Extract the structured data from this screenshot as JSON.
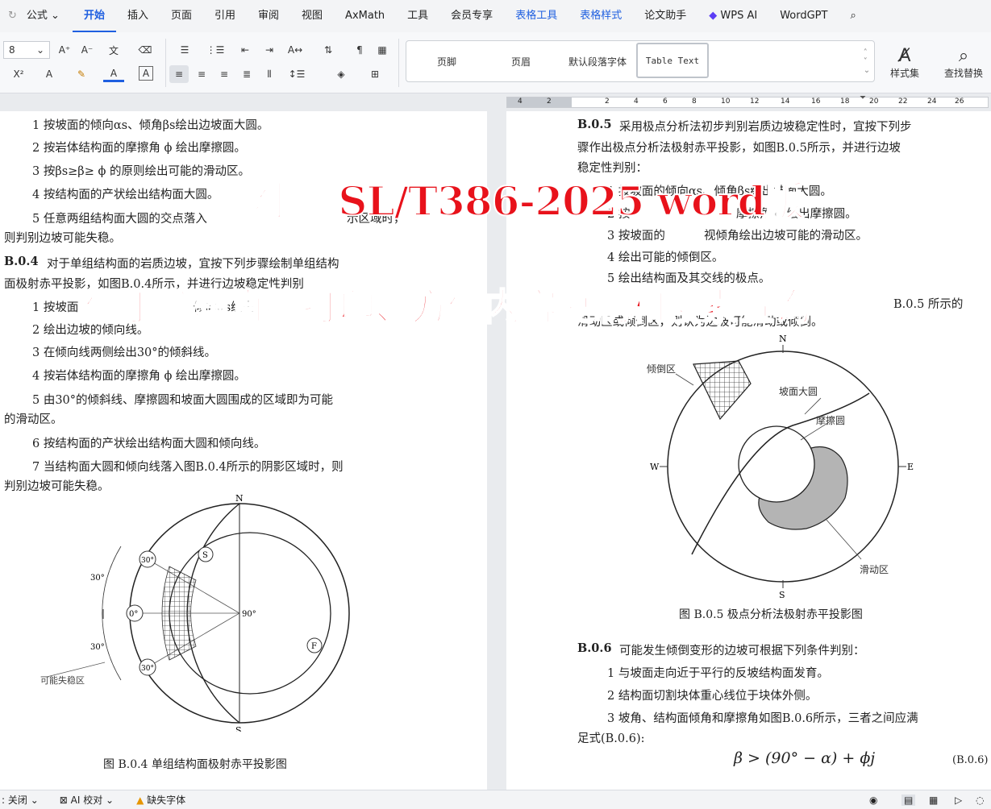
{
  "tabs": {
    "formula": "公式",
    "start": "开始",
    "insert": "插入",
    "page": "页面",
    "reference": "引用",
    "review": "审阅",
    "view": "视图",
    "axmath": "AxMath",
    "tools": "工具",
    "member": "会员专享",
    "table_tools": "表格工具",
    "table_style": "表格样式",
    "paper": "论文助手",
    "wps_ai": "WPS AI",
    "wordgpt": "WordGPT"
  },
  "ribbon": {
    "font_size": "8",
    "styles": [
      "页脚",
      "页眉",
      "默认段落字体",
      "Table Text"
    ],
    "styles_set": "样式集",
    "find_replace": "查找替换"
  },
  "ruler": [
    "4",
    "2",
    "2",
    "4",
    "6",
    "8",
    "10",
    "12",
    "14",
    "16",
    "18",
    "20",
    "22",
    "24",
    "26"
  ],
  "left": {
    "l1": "1 按坡面的倾向αs、倾角βs绘出边坡面大圆。",
    "l2": "2 按岩体结构面的摩擦角 ϕ 绘出摩擦圆。",
    "l3": "3 按βs≥β≥ ϕ 的原则绘出可能的滑动区。",
    "l4": "4 按结构面的产状绘出结构面大圆。",
    "l5": "5 任意两组结构面大圆的交点落入",
    "l5b": "示区域时，",
    "l6": "则判别边坡可能失稳。",
    "b4head": "B.0.4",
    "b4": "对于单组结构面的岩质边坡，宜按下列步骤绘制单组结构",
    "b4b": "面极射赤平投影，如图B.0.4所示，并进行边坡稳定性判别",
    "s1": "1 按坡面",
    "s1b": "倾向αs绘出",
    "s2": "2 绘出边坡的倾向线。",
    "s3": "3 在倾向线两侧绘出30°的倾斜线。",
    "s4": "4 按岩体结构面的摩擦角 ϕ 绘出摩擦圆。",
    "s5": "5 由30°的倾斜线、摩擦圆和坡面大圆围成的区域即为可能",
    "s5b": "的滑动区。",
    "s6": "6 按结构面的产状绘出结构面大圆和倾向线。",
    "s7": "7 当结构面大圆和倾向线落入图B.0.4所示的阴影区域时，则",
    "s7b": "判别边坡可能失稳。",
    "fig_caption": "图 B.0.4  单组结构面极射赤平投影图",
    "fig": {
      "n": "N",
      "s": "S",
      "deg90": "90°",
      "deg0": "0°",
      "deg30a": "30°",
      "deg30b": "30°",
      "ang30a": "30°",
      "ang30b": "30°",
      "circle_s": "S",
      "circle_f": "F",
      "unstable": "可能失稳区"
    }
  },
  "right": {
    "b5head": "B.0.5",
    "b5": "采用极点分析法初步判别岩质边坡稳定性时，宜按下列步",
    "b5b": "骤作出极点分析法极射赤平投影，如图B.0.5所示，并进行边坡",
    "b5c": "稳定性判别：",
    "r1": "1 按坡面的倾向αs、倾角βs绘出坡面大圆。",
    "r2": "2 按",
    "r2b": "摩擦角 ϕ 绘出摩擦圆。",
    "r3": "3 按坡面的",
    "r3b": "视倾角绘出边坡可能的滑动区。",
    "r4": "4 绘出可能的倾倒区。",
    "r5": "5 绘出结构面及其交线的极点。",
    "r6": "B.0.5 所示的",
    "r6b": "滑动区或倾倒区，则认为边坡可能滑动或倾倒。",
    "fig": {
      "n": "N",
      "s": "S",
      "w": "W",
      "e": "E",
      "topple": "倾倒区",
      "slope_circle": "坡面大圆",
      "friction": "摩擦圆",
      "slide": "滑动区"
    },
    "fig_caption": "图 B.0.5  极点分析法极射赤平投影图",
    "b6head": "B.0.6",
    "b6": "可能发生倾倒变形的边坡可根据下列条件判别：",
    "c1": "1 与坡面走向近于平行的反坡结构面发育。",
    "c2": "2 结构面切割块体重心线位于块体外侧。",
    "c3": "3 坡角、结构面倾角和摩擦角如图B.0.6所示，三者之间应满",
    "c3b": "足式(B.0.6):",
    "formula": "β > (90° − α) + ϕj",
    "formula_no": "(B.0.6)"
  },
  "overlay": {
    "line1": "附赠 SL/T386-2025 word版",
    "line2": "便于编辑直接打印、方便内容复制和搜索查询"
  },
  "status": {
    "close": "关闭",
    "ai_check": "AI 校对",
    "missing_font": "缺失字体"
  }
}
